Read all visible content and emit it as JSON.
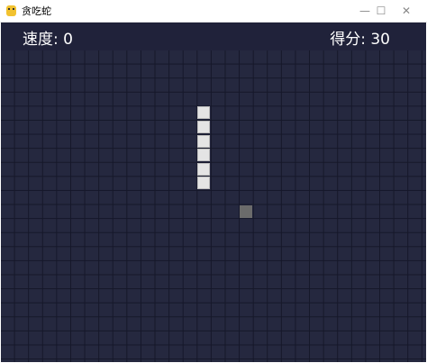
{
  "window": {
    "title": "贪吃蛇",
    "minimize_glyph": "—",
    "maximize_glyph": "☐",
    "close_glyph": "✕"
  },
  "hud": {
    "speed_text": "速度: 0",
    "score_text": "得分: 30"
  },
  "colors": {
    "background": "#20223a",
    "grid_line": "#151729",
    "snake": "#e4e4e4",
    "food": "#6b6b6b"
  },
  "board": {
    "snake": [
      [
        14,
        4
      ],
      [
        14,
        5
      ],
      [
        14,
        6
      ],
      [
        14,
        7
      ],
      [
        14,
        8
      ],
      [
        14,
        9
      ]
    ],
    "food": [
      17,
      11
    ]
  }
}
